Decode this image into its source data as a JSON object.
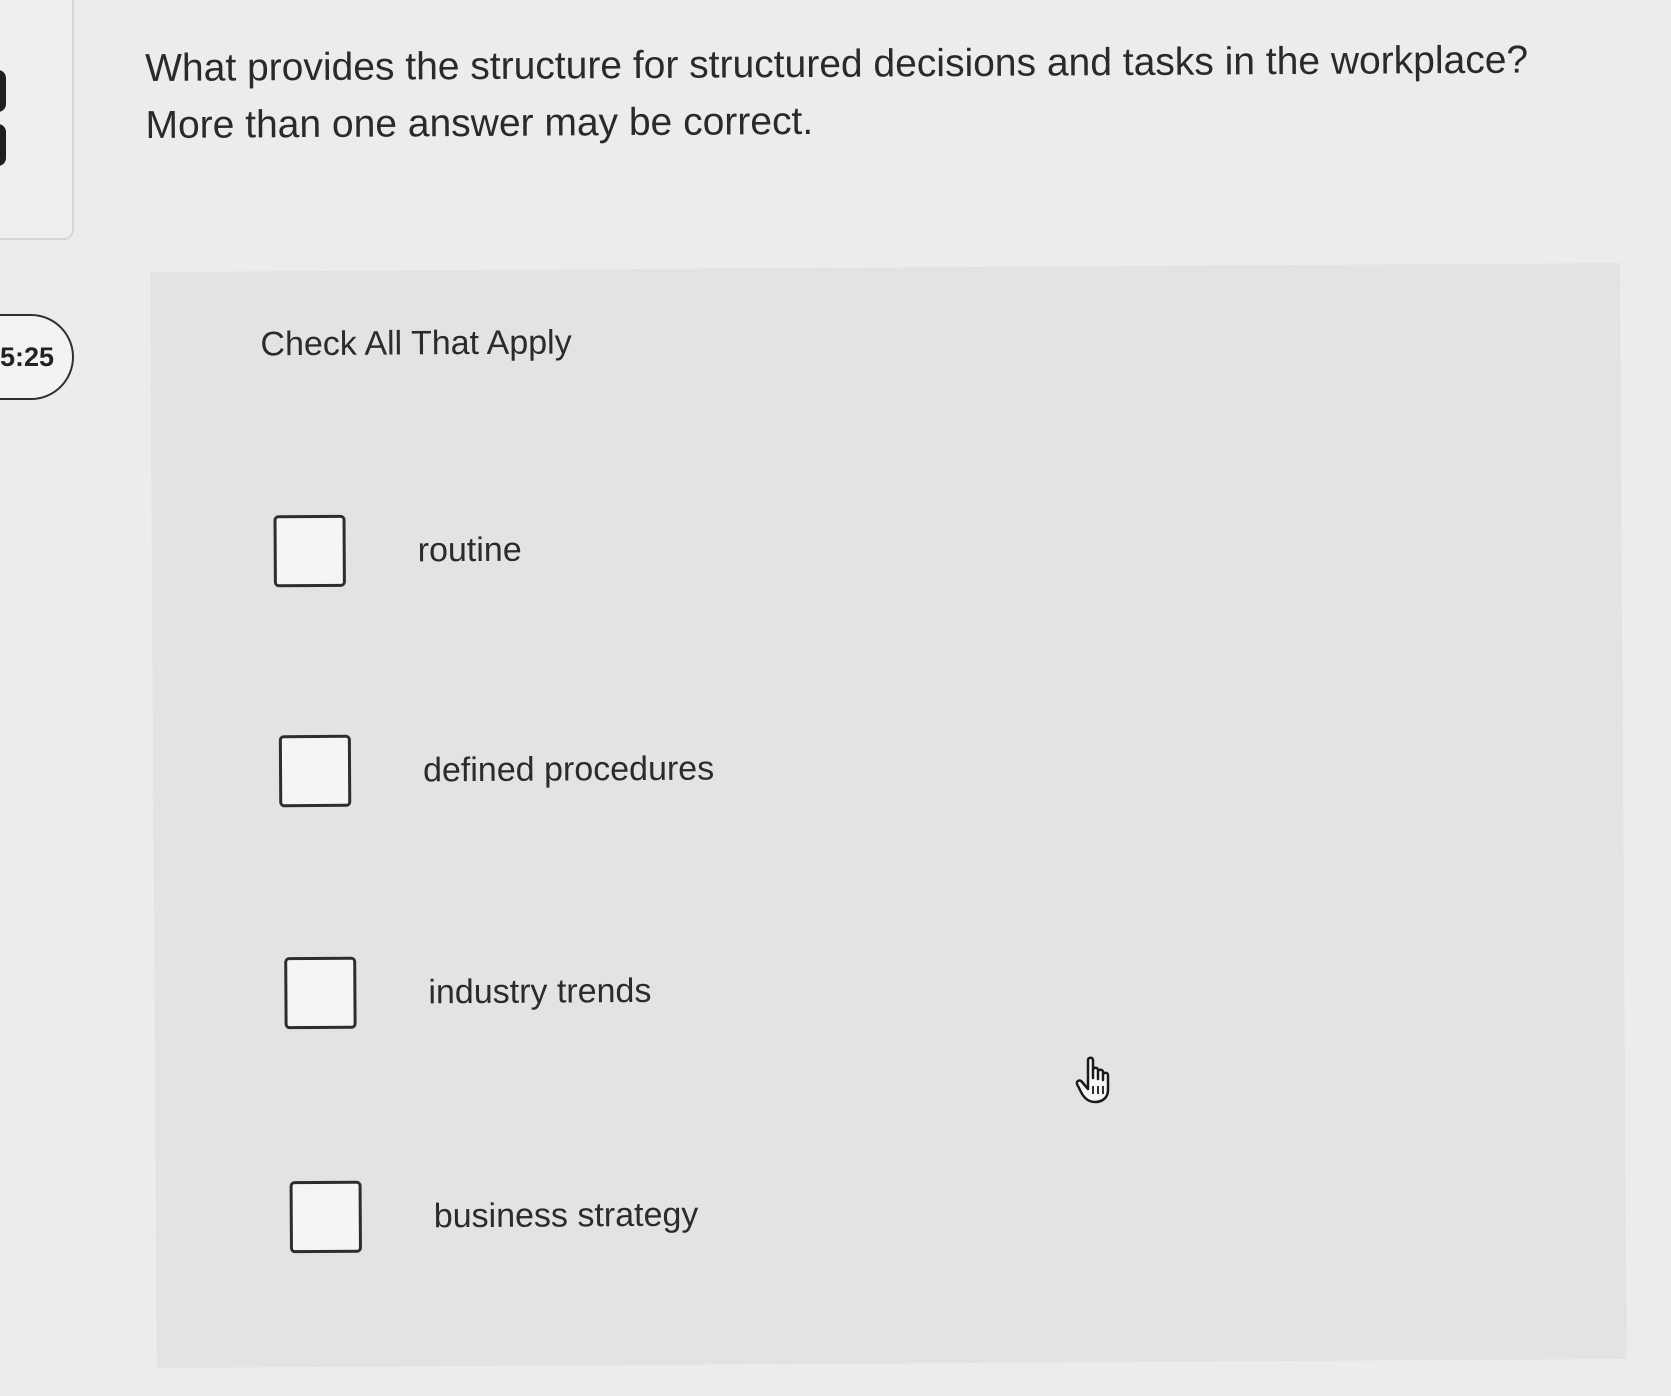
{
  "timer": {
    "value": "5:25"
  },
  "question": {
    "line1": "What provides the structure for structured decisions and tasks in the workplace?",
    "line2": "More than one answer may be correct."
  },
  "answers": {
    "instruction": "Check All That Apply",
    "options": [
      {
        "label": "routine",
        "checked": false
      },
      {
        "label": "defined procedures",
        "checked": false
      },
      {
        "label": "industry trends",
        "checked": false
      },
      {
        "label": "business strategy",
        "checked": false
      }
    ]
  },
  "icons": {
    "cursor": "hand-pointer-icon"
  }
}
